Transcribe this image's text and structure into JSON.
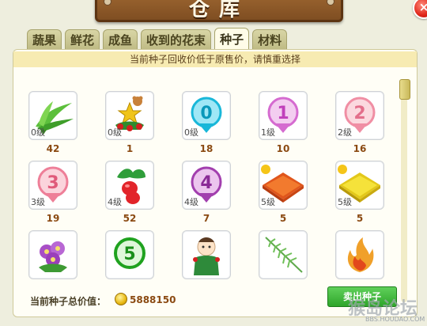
{
  "window": {
    "title": "仓库",
    "close_label": "×"
  },
  "tabs": [
    {
      "label": "蔬果",
      "active": false
    },
    {
      "label": "鲜花",
      "active": false
    },
    {
      "label": "成鱼",
      "active": false
    },
    {
      "label": "收到的花束",
      "active": false
    },
    {
      "label": "种子",
      "active": true
    },
    {
      "label": "材料",
      "active": false
    }
  ],
  "notice": "当前种子回收价低于原售价，请慎重选择",
  "items": [
    {
      "icon": "grass-seed-icon",
      "level": "0级",
      "count": "42"
    },
    {
      "icon": "christmas-decoration-icon",
      "level": "0级",
      "count": "1"
    },
    {
      "icon": "number-0-balloon-icon",
      "level": "0级",
      "count": "18"
    },
    {
      "icon": "number-1-balloon-icon",
      "level": "1级",
      "count": "10"
    },
    {
      "icon": "number-2-balloon-icon",
      "level": "2级",
      "count": "16"
    },
    {
      "icon": "number-3-balloon-icon",
      "level": "3级",
      "count": "19"
    },
    {
      "icon": "red-radish-icon",
      "level": "4级",
      "count": "52"
    },
    {
      "icon": "number-4-balloon-icon",
      "level": "4级",
      "count": "7"
    },
    {
      "icon": "red-flower-bed-icon",
      "level": "5级",
      "count": "5"
    },
    {
      "icon": "yellow-flower-bed-icon",
      "level": "5级",
      "count": "5"
    },
    {
      "icon": "purple-flower-icon",
      "level": "",
      "count": ""
    },
    {
      "icon": "number-5-balloon-icon",
      "level": "",
      "count": ""
    },
    {
      "icon": "doll-icon",
      "level": "",
      "count": ""
    },
    {
      "icon": "fern-icon",
      "level": "",
      "count": ""
    },
    {
      "icon": "flame-flower-icon",
      "level": "",
      "count": ""
    }
  ],
  "footer": {
    "total_label": "当前种子总价值：",
    "total_value": "5888150",
    "sell_button": "卖出种子",
    "watermark": "猴岛论坛",
    "watermark_url": "BBS.HOUDAO.COM"
  },
  "colors": {
    "accent": "#8b4a12",
    "sell_button": "#2ea52a",
    "panel": "#fffef6"
  }
}
